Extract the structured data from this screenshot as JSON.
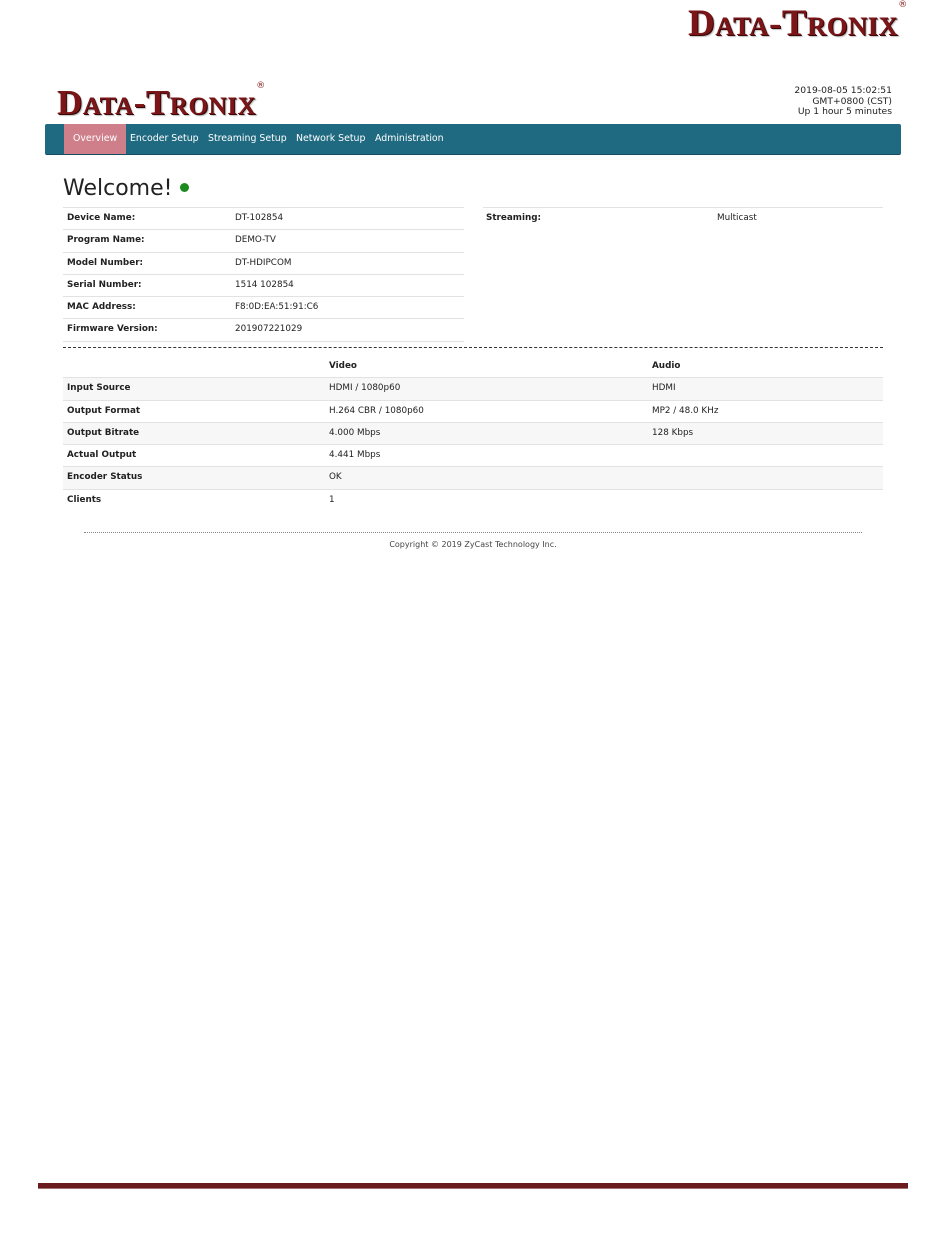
{
  "document": {
    "logo_text_D": "D",
    "logo_text_ata": "ATA",
    "logo_text_dash": "-",
    "logo_text_T": "T",
    "logo_text_ronix": "RONIX",
    "logo_registered": "®",
    "brand_color": "#7b1518"
  },
  "header": {
    "logo_text_D": "D",
    "logo_text_ata": "ATA",
    "logo_text_dash": "-",
    "logo_text_T": "T",
    "logo_text_ronix": "RONIX",
    "logo_registered": "®",
    "datetime": "2019-08-05 15:02:51",
    "timezone": "GMT+0800 (CST)",
    "uptime": "Up 1 hour 5 minutes"
  },
  "nav": {
    "color": "#1f6a80",
    "active_color": "#cf7f8a",
    "items": [
      {
        "label": "Overview",
        "active": true
      },
      {
        "label": "Encoder Setup",
        "active": false
      },
      {
        "label": "Streaming Setup",
        "active": false
      },
      {
        "label": "Network Setup",
        "active": false
      },
      {
        "label": "Administration",
        "active": false
      }
    ]
  },
  "main": {
    "title": "Welcome!",
    "status_dot_color": "#1c8a1c",
    "device_info": [
      {
        "label": "Device Name:",
        "value": "DT-102854"
      },
      {
        "label": "Program Name:",
        "value": "DEMO-TV"
      },
      {
        "label": "Model Number:",
        "value": "DT-HDIPCOM"
      },
      {
        "label": "Serial Number:",
        "value": "1514 102854"
      },
      {
        "label": "MAC Address:",
        "value": "F8:0D:EA:51:91:C6"
      },
      {
        "label": "Firmware Version:",
        "value": "201907221029"
      }
    ],
    "streaming": {
      "label": "Streaming:",
      "value": "Multicast"
    },
    "encoder_table": {
      "headers": [
        "",
        "Video",
        "Audio"
      ],
      "rows": [
        [
          "Input Source",
          "HDMI / 1080p60",
          "HDMI"
        ],
        [
          "Output Format",
          "H.264 CBR / 1080p60",
          "MP2 / 48.0 KHz"
        ],
        [
          "Output Bitrate",
          "4.000 Mbps",
          "128 Kbps"
        ],
        [
          "Actual Output",
          "4.441 Mbps",
          ""
        ],
        [
          "Encoder Status",
          "OK",
          ""
        ],
        [
          "Clients",
          "1",
          ""
        ]
      ]
    }
  },
  "footer": {
    "copyright": "Copyright © 2019 ZyCast Technology Inc."
  }
}
